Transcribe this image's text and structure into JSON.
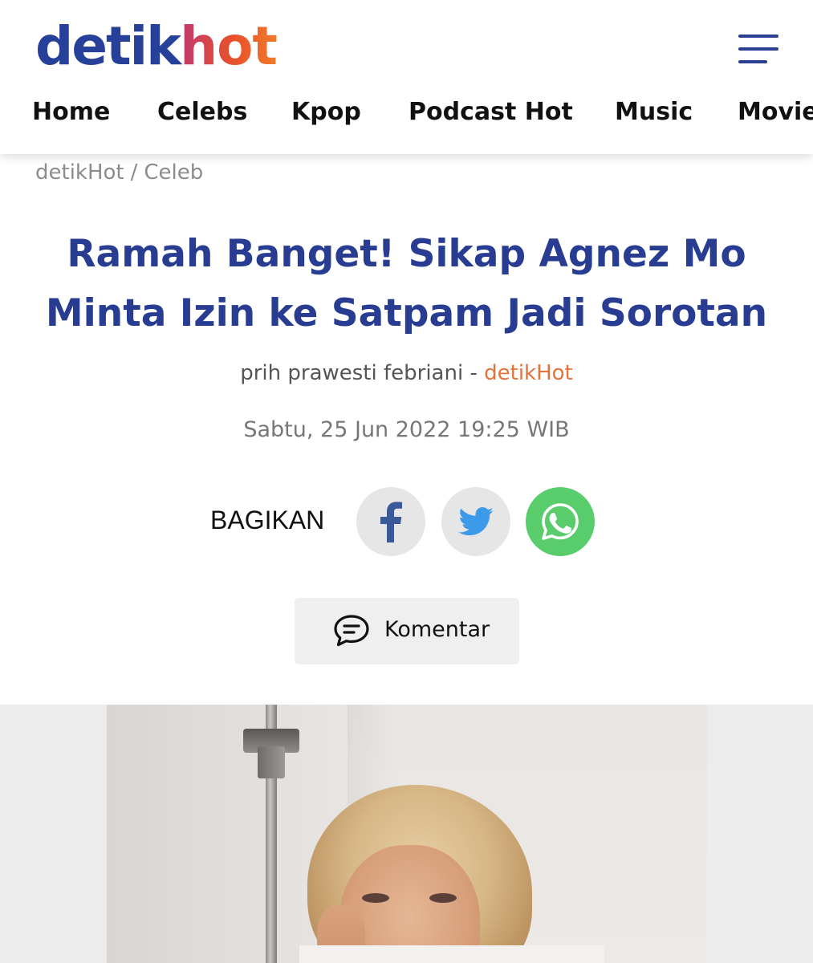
{
  "header": {
    "logo": {
      "part1": "detik",
      "part2": "hot"
    },
    "nav": [
      {
        "label": "Home"
      },
      {
        "label": "Celebs"
      },
      {
        "label": "Kpop"
      },
      {
        "label": "Podcast Hot"
      },
      {
        "label": "Music"
      },
      {
        "label": "Movie"
      }
    ]
  },
  "breadcrumb": {
    "root": "detikHot",
    "separator": "/",
    "section": "Celeb"
  },
  "article": {
    "title_line1": "Ramah Banget! Sikap Agnez Mo",
    "title_line2": "Minta Izin ke Satpam Jadi Sorotan",
    "author": "prih prawesti febriani",
    "byline_sep": "-",
    "source": "detikHot",
    "date": "Sabtu, 25 Jun 2022 19:25 WIB"
  },
  "share": {
    "label": "BAGIKAN",
    "buttons": [
      {
        "icon": "facebook-icon",
        "color": "#3b5998"
      },
      {
        "icon": "twitter-icon",
        "color": "#3d9ae8"
      },
      {
        "icon": "whatsapp-icon",
        "color": "#ffffff"
      }
    ]
  },
  "comment": {
    "label": "Komentar",
    "icon": "comment-icon"
  },
  "colors": {
    "brand_blue": "#283d92",
    "source_orange": "#e2733b",
    "whatsapp_green": "#59cc6b"
  }
}
